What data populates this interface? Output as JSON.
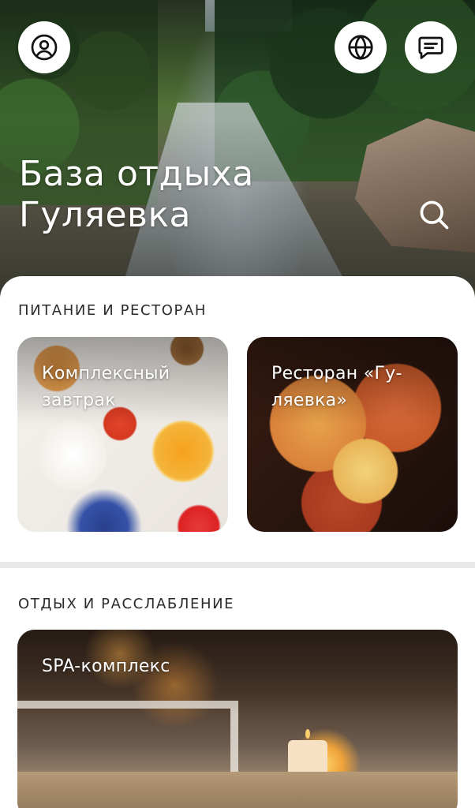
{
  "header": {
    "title": "База отдыха Гуляевка",
    "title_line1": "База отдыха",
    "title_line2": "Гуляевка",
    "icons": {
      "profile": "user-circle-icon",
      "language": "globe-icon",
      "chat": "message-icon",
      "search": "search-icon"
    }
  },
  "sections": [
    {
      "title": "ПИТАНИЕ И РЕСТОРАН",
      "cards": [
        {
          "title": "Комплексный завтрак"
        },
        {
          "title": "Ресторан «Гу-ляевка»"
        }
      ]
    },
    {
      "title": "ОТДЫХ И РАССЛАБЛЕНИЕ",
      "cards": [
        {
          "title": "SPA-комплекс"
        }
      ]
    }
  ],
  "colors": {
    "background": "#ffffff",
    "section_text": "#2b2b2b",
    "divider": "#e9e9ea",
    "overlay_text": "#ffffff"
  }
}
